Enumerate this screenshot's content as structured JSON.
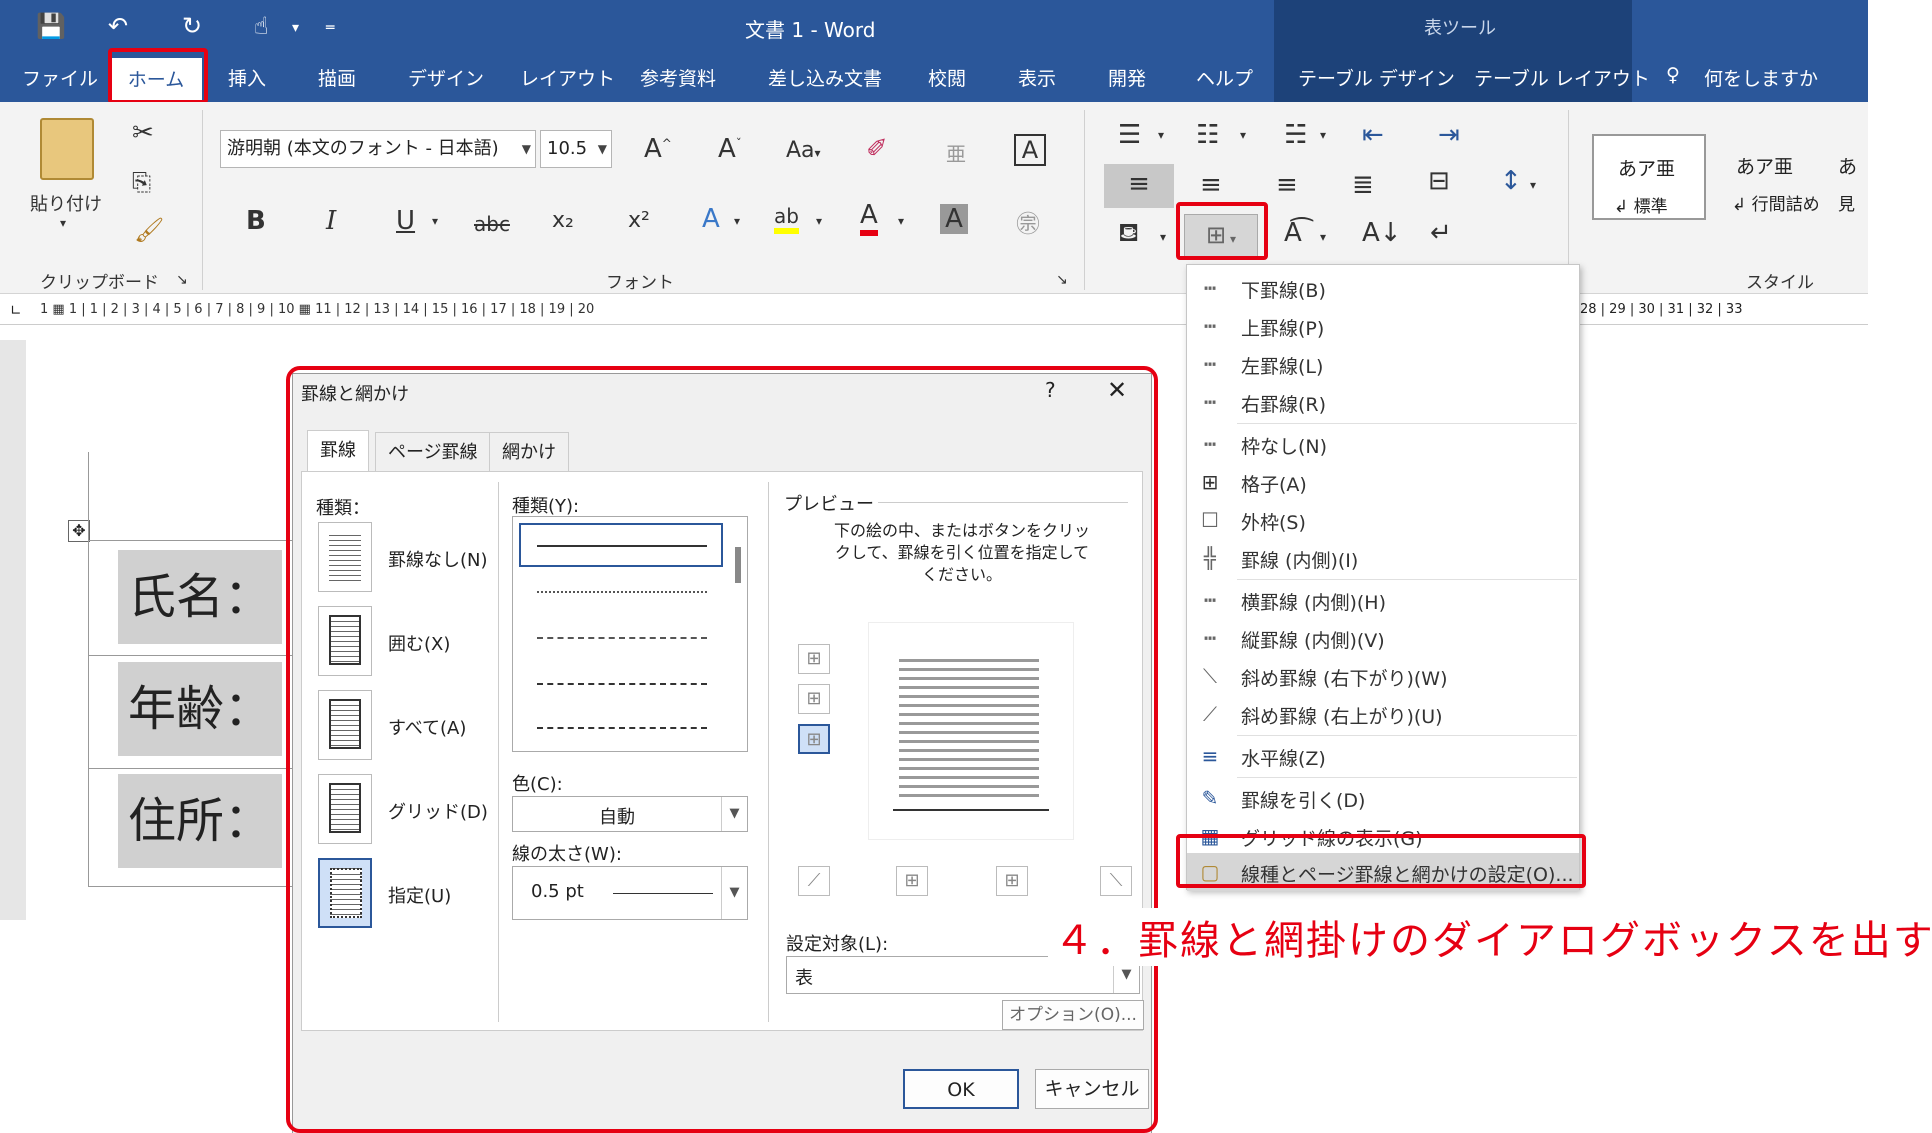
{
  "titlebar": {
    "doc_title": "文書 1  -  Word",
    "tool_tab_group": "表ツール"
  },
  "ribbon_tabs": [
    "ファイル",
    "ホーム",
    "挿入",
    "描画",
    "デザイン",
    "レイアウト",
    "参考資料",
    "差し込み文書",
    "校閲",
    "表示",
    "開発",
    "ヘルプ",
    "テーブル デザイン",
    "テーブル レイアウト"
  ],
  "tell_me": "何をしますか",
  "clipboard": {
    "paste_label": "貼り付け",
    "group_label": "クリップボード"
  },
  "font": {
    "name": "游明朝 (本文のフォント - 日本語)",
    "size": "10.5",
    "group_label": "フォント",
    "bold": "B",
    "italic": "I",
    "underline": "U",
    "strike": "abc",
    "sub": "x₂",
    "sup": "x²",
    "case": "Aa"
  },
  "styles": {
    "group_label": "スタイル",
    "card1_sample": "あア亜",
    "card1_name": "↲ 標準",
    "card2_sample": "あア亜",
    "card2_name": "↲ 行間詰め",
    "card3_sample": "あ",
    "card3_name": "見"
  },
  "ruler_numbers": "1  ▦   1   |   1   |   2   |   3   |   4   |   5   |   6   |   7   |   8   |   9   |  10  ▦  11  |  12  |  13  |  14  |  15  |  16  |  17  |  18  |  19  |  20",
  "ruler_numbers_right": "28  |  29  |  30  |  31  |  32  |  33",
  "document": {
    "row1": "氏名：",
    "row2": "年齢：",
    "row3": "住所："
  },
  "border_menu": [
    {
      "icon": "┅",
      "label": "下罫線(B)"
    },
    {
      "icon": "┅",
      "label": "上罫線(P)"
    },
    {
      "icon": "┅",
      "label": "左罫線(L)"
    },
    {
      "icon": "┅",
      "label": "右罫線(R)"
    },
    {
      "icon": "┅",
      "label": "枠なし(N)"
    },
    {
      "icon": "⊞",
      "label": "格子(A)"
    },
    {
      "icon": "☐",
      "label": "外枠(S)"
    },
    {
      "icon": "╬",
      "label": "罫線 (内側)(I)"
    },
    {
      "icon": "┅",
      "label": "横罫線 (内側)(H)"
    },
    {
      "icon": "┅",
      "label": "縦罫線 (内側)(V)"
    },
    {
      "icon": "⟍",
      "label": "斜め罫線 (右下がり)(W)"
    },
    {
      "icon": "⟋",
      "label": "斜め罫線 (右上がり)(U)"
    },
    {
      "icon": "≡",
      "label": "水平線(Z)"
    },
    {
      "icon": "✎",
      "label": "罫線を引く(D)"
    },
    {
      "icon": "▦",
      "label": "グリッド線の表示(G)"
    },
    {
      "icon": "▢",
      "label": "線種とページ罫線と網かけの設定(O)..."
    }
  ],
  "dialog": {
    "title": "罫線と網かけ",
    "help": "?",
    "close": "✕",
    "tabs": [
      "罫線",
      "ページ罫線",
      "網かけ"
    ],
    "setting_label": "種類：",
    "settings": [
      "罫線なし(N)",
      "囲む(X)",
      "すべて(A)",
      "グリッド(D)",
      "指定(U)"
    ],
    "style_label": "種類(Y):",
    "color_label": "色(C):",
    "color_value": "自動",
    "width_label": "線の太さ(W):",
    "width_value": "0.5 pt",
    "preview_label": "プレビュー",
    "preview_hint": "下の絵の中、またはボタンをクリックして、罫線を引く位置を指定してください。",
    "apply_label": "設定対象(L):",
    "apply_value": "表",
    "options_button": "オプション(O)...",
    "ok": "OK",
    "cancel": "キャンセル"
  },
  "annotation": "４．罫線と網掛けのダイアログボックスを出す",
  "colors": {
    "word_blue": "#2b579a",
    "highlight_red": "#e60012"
  }
}
